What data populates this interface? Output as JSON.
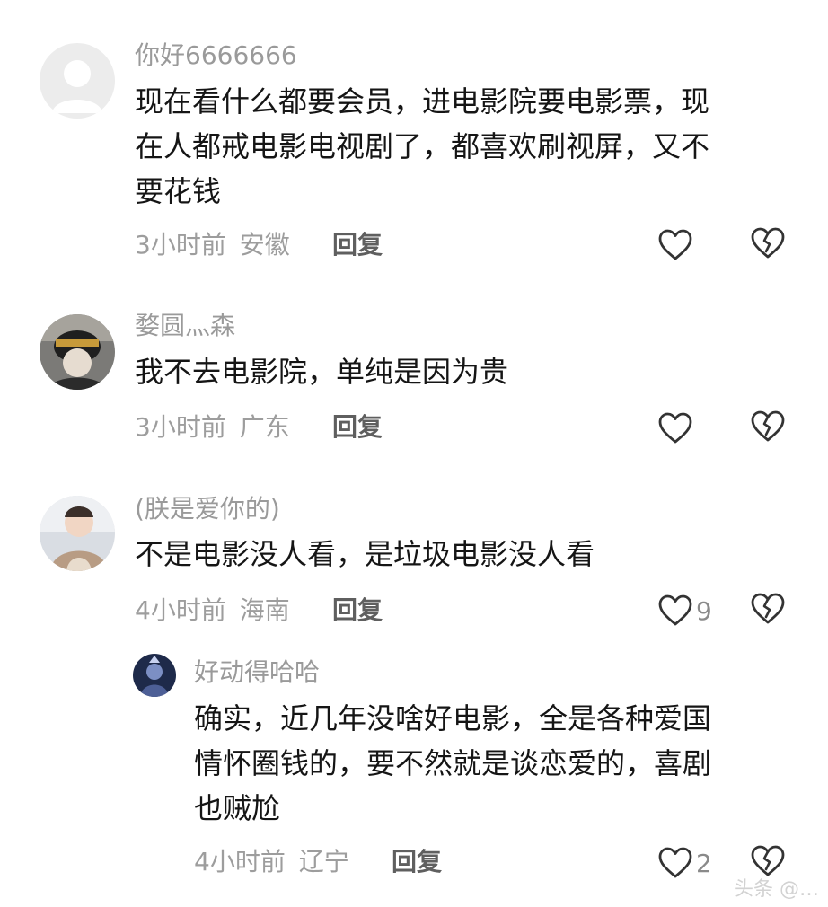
{
  "comments": [
    {
      "username": "你好6666666",
      "text": "现在看什么都要会员，进电影院要电影票，现在人都戒电影电视剧了，都喜欢刷视屏，又不要花钱",
      "lines": [
        "现在看什么都要会员，进电影院要电影票，现",
        "在人都戒电影电视剧了，都喜欢刷视屏，又不",
        "要花钱"
      ],
      "time": "3小时前",
      "location": "安徽",
      "reply_label": "回复",
      "likes": ""
    },
    {
      "username": "婺圆灬森",
      "text": "我不去电影院，单纯是因为贵",
      "lines": [
        "我不去电影院，单纯是因为贵"
      ],
      "time": "3小时前",
      "location": "广东",
      "reply_label": "回复",
      "likes": ""
    },
    {
      "username": "(朕是爱你的)",
      "text": "不是电影没人看，是垃圾电影没人看",
      "lines": [
        "不是电影没人看，是垃圾电影没人看"
      ],
      "time": "4小时前",
      "location": "海南",
      "reply_label": "回复",
      "likes": "9"
    },
    {
      "username": "好动得哈哈",
      "text": "确实，近几年没啥好电影，全是各种爱国情怀圈钱的，要不然就是谈恋爱的，喜剧也贼尬",
      "lines": [
        "确实，近几年没啥好电影，全是各种爱国",
        "情怀圈钱的，要不然就是谈恋爱的，喜剧",
        "也贼尬"
      ],
      "time": "4小时前",
      "location": "辽宁",
      "reply_label": "回复",
      "likes": "2"
    }
  ],
  "colors": {
    "username": "#9a9a9a",
    "text": "#151515",
    "meta": "#9d9d9d",
    "reply": "#5f5f5f",
    "icon": "#333333"
  },
  "icons": {
    "like": "heart-outline-icon",
    "dislike": "broken-heart-icon"
  },
  "watermark": "头条 @…"
}
